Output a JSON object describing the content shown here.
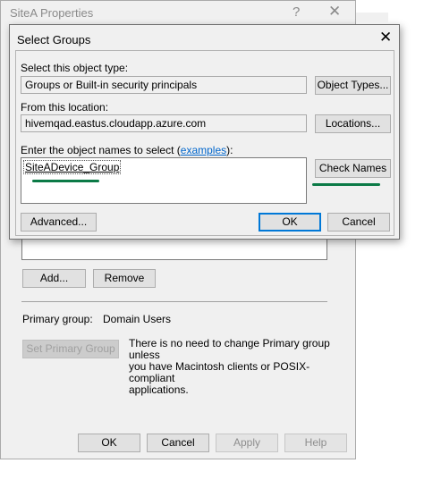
{
  "props_window": {
    "title": "SiteA Properties",
    "help_glyph": "?",
    "close_glyph": "✕",
    "add_label": "Add...",
    "remove_label": "Remove",
    "primary_group_label": "Primary group:",
    "primary_group_value": "Domain Users",
    "set_primary_label": "Set Primary Group",
    "info_text_lines": [
      "There is no need to change Primary group unless",
      "you have Macintosh clients or POSIX-compliant",
      "applications."
    ],
    "ok_label": "OK",
    "cancel_label": "Cancel",
    "apply_label": "Apply",
    "help_label": "Help"
  },
  "dialog": {
    "title": "Select Groups",
    "close_glyph": "✕",
    "object_type_label": "Select this object type:",
    "object_type_value": "Groups or Built-in security principals",
    "object_types_button": "Object Types...",
    "location_label": "From this location:",
    "location_value": "hivemqad.eastus.cloudapp.azure.com",
    "locations_button": "Locations...",
    "enter_names_label_prefix": "Enter the object names to select (",
    "enter_names_link": "examples",
    "enter_names_label_suffix": "):",
    "names_value": "SiteADevice_Group",
    "check_names_button": "Check Names",
    "advanced_button": "Advanced...",
    "ok_button": "OK",
    "cancel_button": "Cancel"
  },
  "colors": {
    "annotation_green": "#0b7a46",
    "focus_blue": "#0078d7",
    "link_blue": "#0066cc"
  }
}
